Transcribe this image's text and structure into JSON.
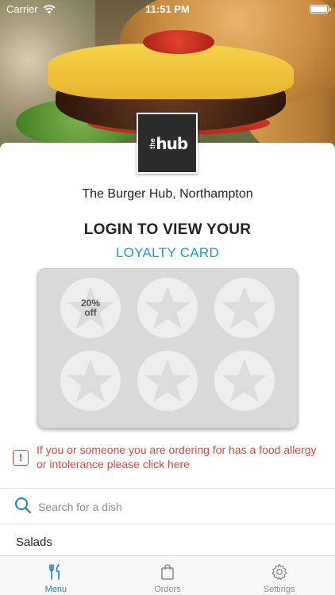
{
  "status_bar": {
    "carrier": "Carrier",
    "time": "11:51 PM"
  },
  "venue": {
    "name": "The Burger Hub, Northampton",
    "logo_small": "the",
    "logo_main": "hub"
  },
  "login": {
    "title": "LOGIN TO VIEW YOUR",
    "subtitle": "LOYALTY CARD"
  },
  "loyalty_card": {
    "stamps": [
      {
        "label_top": "20%",
        "label_bottom": "off"
      },
      {
        "label_top": "",
        "label_bottom": ""
      },
      {
        "label_top": "",
        "label_bottom": ""
      },
      {
        "label_top": "",
        "label_bottom": ""
      },
      {
        "label_top": "",
        "label_bottom": ""
      },
      {
        "label_top": "",
        "label_bottom": ""
      }
    ]
  },
  "allergy_notice": {
    "text": "If you or someone you are ordering for has a food allergy or intolerance please click here"
  },
  "search": {
    "placeholder": "Search for a dish"
  },
  "menu": {
    "first_section": "Salads"
  },
  "tabbar": {
    "items": [
      {
        "label": "Menu"
      },
      {
        "label": "Orders"
      },
      {
        "label": "Settings"
      }
    ]
  },
  "colors": {
    "accent": "#1c7fc4",
    "loyalty_text": "#1c9bc9",
    "warning": "#d24a3c"
  }
}
